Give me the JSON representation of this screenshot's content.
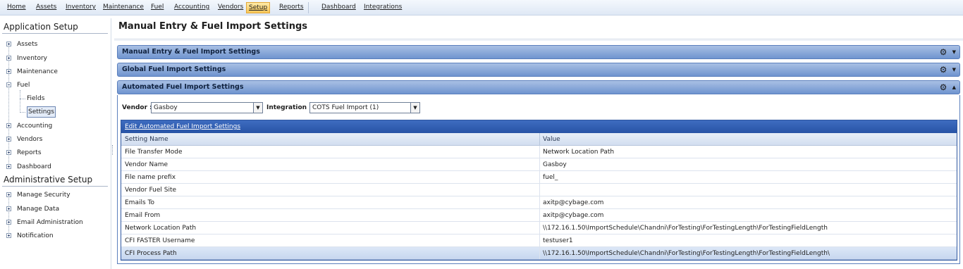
{
  "menu": {
    "home": "Home",
    "assets": "Assets",
    "inventory": "Inventory",
    "maintenance": "Maintenance",
    "fuel": "Fuel",
    "accounting": "Accounting",
    "vendors": "Vendors",
    "setup": "Setup",
    "reports": "Reports",
    "dashboard": "Dashboard",
    "integrations": "Integrations"
  },
  "sidebar": {
    "app_setup_title": "Application Setup",
    "app_items": {
      "assets": "Assets",
      "inventory": "Inventory",
      "maintenance": "Maintenance",
      "fuel": "Fuel",
      "fields": "Fields",
      "settings": "Settings",
      "accounting": "Accounting",
      "vendors": "Vendors",
      "reports": "Reports",
      "dashboard": "Dashboard"
    },
    "admin_setup_title": "Administrative Setup",
    "admin_items": {
      "security": "Manage Security",
      "data": "Manage Data",
      "email": "Email Administration",
      "notification": "Notification"
    }
  },
  "main": {
    "page_title": "Manual Entry & Fuel Import Settings",
    "panels": {
      "manual": "Manual Entry & Fuel Import Settings",
      "global": "Global Fuel Import Settings",
      "automated": "Automated Fuel Import Settings"
    },
    "vendor_label": "Vendor :",
    "vendor_value": "Gasboy",
    "integration_label": "Integration :",
    "integration_value": "COTS Fuel Import (1)",
    "edit_link": "Edit Automated Fuel Import Settings",
    "col_setting": "Setting Name",
    "col_value": "Value",
    "rows": [
      {
        "name": "File Transfer Mode",
        "value": "Network Location Path"
      },
      {
        "name": "Vendor Name",
        "value": "Gasboy"
      },
      {
        "name": "File name prefix",
        "value": "fuel_"
      },
      {
        "name": "Vendor Fuel Site",
        "value": ""
      },
      {
        "name": "Emails To",
        "value": "axitp@cybage.com"
      },
      {
        "name": "Email From",
        "value": "axitp@cybage.com"
      },
      {
        "name": "Network Location Path",
        "value": "\\\\172.16.1.50\\ImportSchedule\\Chandni\\ForTesting\\ForTestingLength\\ForTestingFieldLength"
      },
      {
        "name": "CFI FASTER Username",
        "value": "testuser1"
      },
      {
        "name": "CFI Process Path",
        "value": "\\\\172.16.1.50\\ImportSchedule\\Chandni\\ForTesting\\ForTestingLength\\ForTestingFieldLength\\"
      }
    ]
  },
  "icons": {
    "gear": "gear-icon",
    "expand": "chevron-down-icon",
    "collapse": "chevron-up-icon",
    "dropdown": "dropdown-arrow-icon",
    "tree_expander": "tree-expander-icon"
  },
  "colors": {
    "panel_header": "#7b9dd4",
    "grid_caption": "#2f5aa8",
    "active_menu": "#f6c65a"
  }
}
